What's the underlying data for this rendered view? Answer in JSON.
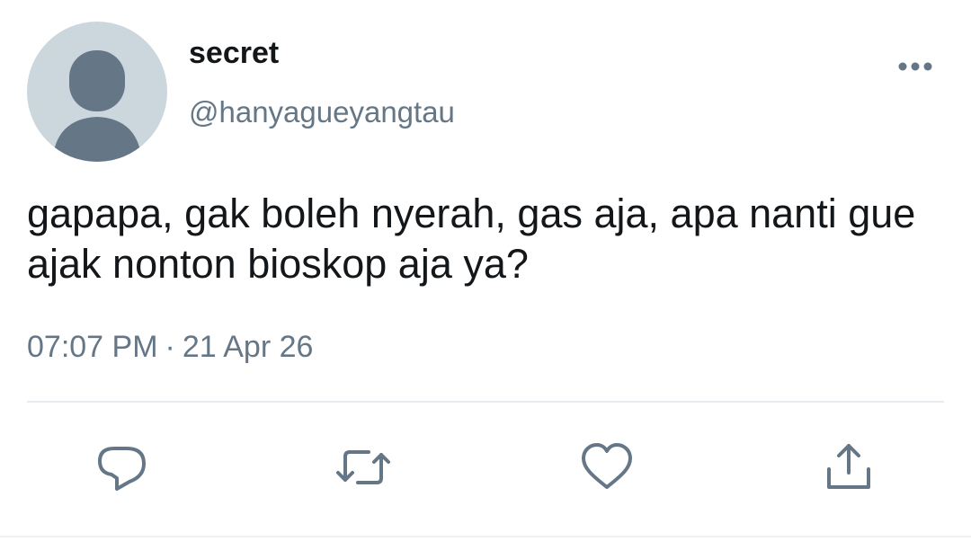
{
  "tweet": {
    "display_name": "secret",
    "handle": "@hanyagueyangtau",
    "text": "gapapa, gak boleh nyerah, gas aja, apa nanti gue ajak nonton bioskop aja ya?",
    "time": "07:07 PM",
    "separator": "·",
    "date": "21 Apr 26"
  },
  "avatar": {
    "icon": "default-profile-silhouette-icon",
    "background_color": "#ccd6dd",
    "silhouette_color": "#657786"
  },
  "actions": [
    {
      "name": "reply",
      "icon": "reply-icon"
    },
    {
      "name": "retweet",
      "icon": "retweet-icon"
    },
    {
      "name": "like",
      "icon": "heart-icon"
    },
    {
      "name": "share",
      "icon": "share-icon"
    }
  ],
  "colors": {
    "text_primary": "#14171a",
    "text_secondary": "#657786",
    "divider": "#e6ecf0"
  }
}
